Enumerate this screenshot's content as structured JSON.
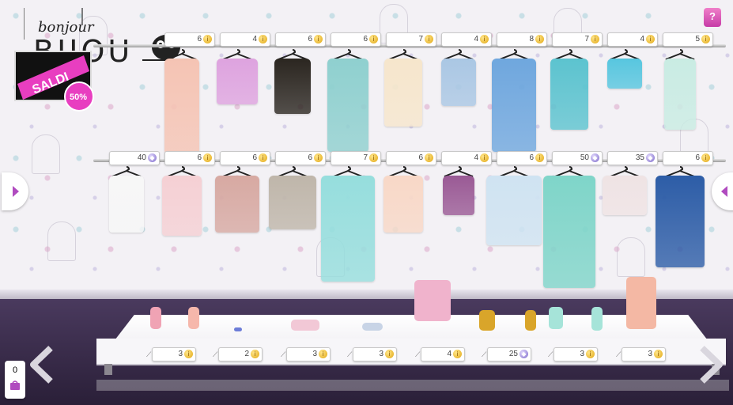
{
  "logo": {
    "top": "bonjour",
    "bottom": "BIJOU"
  },
  "sale": {
    "label": "SALDI",
    "discount": "50%"
  },
  "help": {
    "label": "?"
  },
  "cart": {
    "count": "0"
  },
  "colors": {
    "accent": "#e83ec0",
    "coin": "#e2a712",
    "gem": "#7b68c9",
    "floor": "#3a2d4c"
  },
  "row1": [
    {
      "name": "peach-draped-gown",
      "price": "6",
      "currency": "coin",
      "color": "#f5c4b4"
    },
    {
      "name": "pink-crop-top",
      "price": "4",
      "currency": "coin",
      "color": "#dea3df"
    },
    {
      "name": "black-butterfly-top",
      "price": "6",
      "currency": "coin",
      "color": "#2b2620"
    },
    {
      "name": "aqua-floral-dress",
      "price": "6",
      "currency": "coin",
      "color": "#8fd0cf"
    },
    {
      "name": "cream-star-blazer",
      "price": "7",
      "currency": "coin",
      "color": "#f6e6cc"
    },
    {
      "name": "striped-denim-shorts",
      "price": "4",
      "currency": "coin",
      "color": "#aac7e4"
    },
    {
      "name": "blue-ombre-dress",
      "price": "8",
      "currency": "coin",
      "color": "#6fa7de"
    },
    {
      "name": "turquoise-wrap-bodysuit",
      "price": "7",
      "currency": "coin",
      "color": "#5cc3cf"
    },
    {
      "name": "aqua-bandeau-top",
      "price": "4",
      "currency": "coin",
      "color": "#57c6df"
    },
    {
      "name": "mint-long-cardigan",
      "price": "5",
      "currency": "coin",
      "color": "#c9ece3"
    }
  ],
  "row2": [
    {
      "name": "white-lace-tank",
      "price": "40",
      "currency": "gem",
      "color": "#f7f7f7"
    },
    {
      "name": "pink-star-skirt",
      "price": "6",
      "currency": "coin",
      "color": "#f5d0d4"
    },
    {
      "name": "floral-print-skirt",
      "price": "6",
      "currency": "coin",
      "color": "#d7a9a2"
    },
    {
      "name": "silver-sequin-top",
      "price": "6",
      "currency": "coin",
      "color": "#bfb6aa"
    },
    {
      "name": "mint-starfish-dress",
      "price": "7",
      "currency": "coin",
      "color": "#96dedd"
    },
    {
      "name": "pink-starfish-skirt",
      "price": "6",
      "currency": "coin",
      "color": "#f8d8c7"
    },
    {
      "name": "purple-sequin-cami",
      "price": "4",
      "currency": "coin",
      "color": "#9a5a95"
    },
    {
      "name": "sheer-blue-cape",
      "price": "6",
      "currency": "coin",
      "color": "#cfe3f2"
    },
    {
      "name": "mint-jeans",
      "price": "50",
      "currency": "gem",
      "color": "#7fd5c9"
    },
    {
      "name": "pink-crop-knit",
      "price": "35",
      "currency": "gem",
      "color": "#efe3e4"
    },
    {
      "name": "blue-print-dress",
      "price": "6",
      "currency": "coin",
      "color": "#2d5da7"
    }
  ],
  "accessories": [
    {
      "name": "pink-heels",
      "price": "3",
      "currency": "coin"
    },
    {
      "name": "mini-earrings",
      "price": "2",
      "currency": "coin"
    },
    {
      "name": "pink-bracelet",
      "price": "3",
      "currency": "coin"
    },
    {
      "name": "white-sunglasses",
      "price": "3",
      "currency": "coin"
    },
    {
      "name": "gold-heels",
      "price": "4",
      "currency": "coin"
    },
    {
      "name": "pink-handbag",
      "price": "25",
      "currency": "gem"
    },
    {
      "name": "mint-flats",
      "price": "3",
      "currency": "coin"
    },
    {
      "name": "peach-bucket-bag",
      "price": "3",
      "currency": "coin"
    }
  ]
}
